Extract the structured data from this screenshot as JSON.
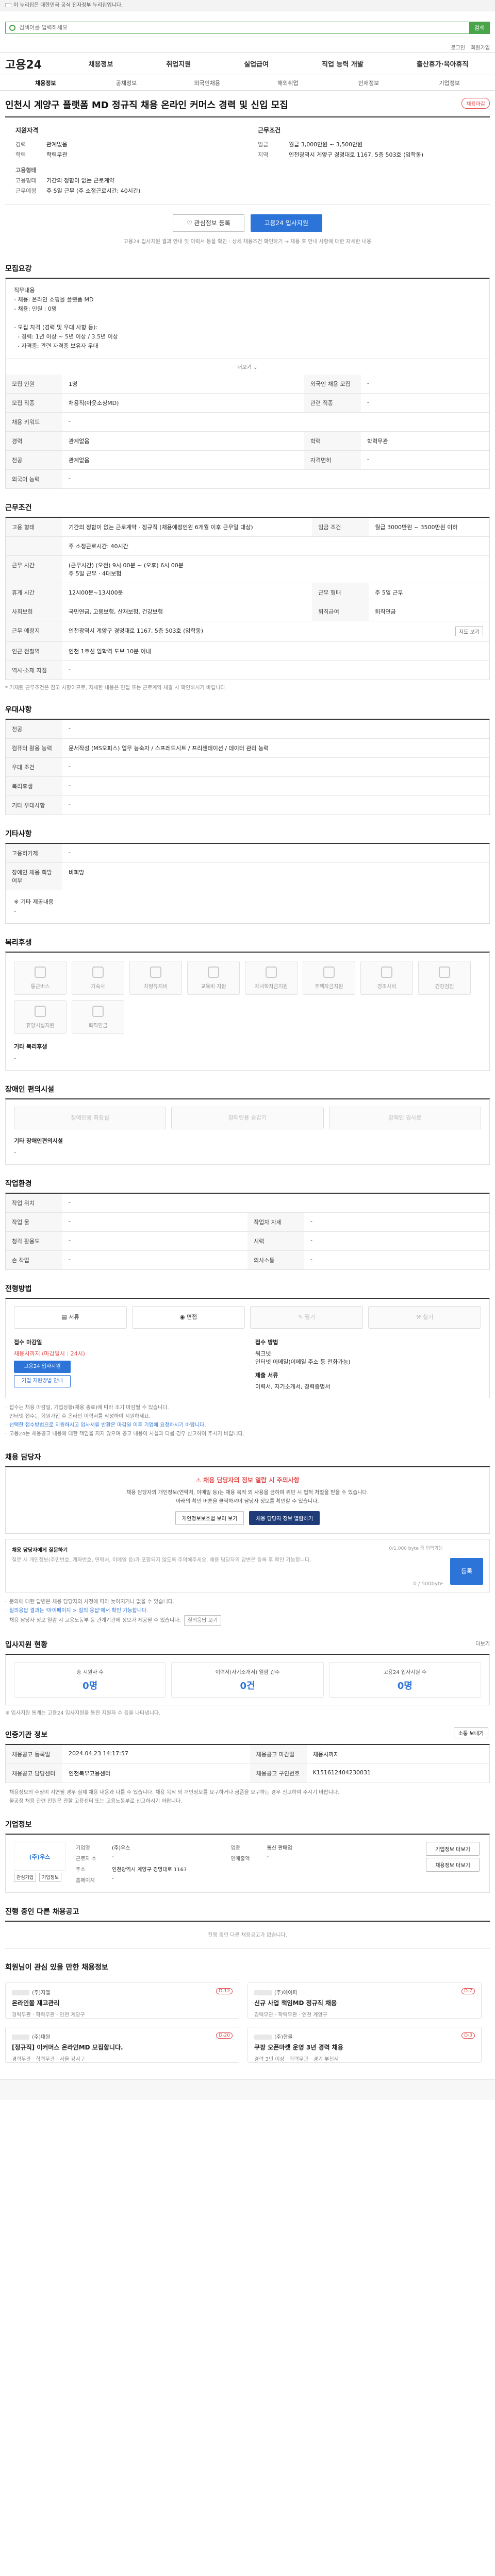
{
  "gov_banner": "이 누리집은 대한민국 공식 전자정부 누리집입니다.",
  "search": {
    "placeholder": "검색어를 입력하세요",
    "button": "검색"
  },
  "utils": [
    "로그인",
    "회원가입"
  ],
  "logo": {
    "text": "고용24"
  },
  "gnb": [
    "채용정보",
    "취업지원",
    "실업급여",
    "직업 능력 개발",
    "출산휴가·육아휴직"
  ],
  "subnav": [
    "채용정보",
    "공채정보",
    "외국인채용",
    "해외취업",
    "인재정보",
    "기업정보"
  ],
  "headline": {
    "title": "인천시 계양구 플랫폼 MD 정규직 채용 온라인 커머스 경력 및 신입 모집",
    "badge": "채용마감"
  },
  "summary": {
    "left": {
      "title": "지원자격",
      "rows": [
        {
          "k": "경력",
          "v": "관계없음"
        },
        {
          "k": "학력",
          "v": "학력무관"
        },
        {
          "k": "고용형태",
          "v": ""
        },
        {
          "k": "고용형태",
          "v": "기간의 정함이 없는 근로계약"
        },
        {
          "k": "근무예정",
          "v": "주 5일 근무 (주 소정근로시간: 40시간)"
        }
      ]
    },
    "right": {
      "title": "근무조건",
      "rows": [
        {
          "k": "임금",
          "v": "월급 3,000만원 ~ 3,500만원"
        },
        {
          "k": "지역",
          "v": "인천광역시 계양구 경명대로 1167, 5층 503호 (임학동)"
        }
      ]
    }
  },
  "actions": {
    "scrap": "관심정보 등록",
    "apply": "고용24 입사지원"
  },
  "actions_note": "고용24 입사지원 결과 안내 및 이력서 등을 확인 : 상세 채용조건 확인하기 → 채용 후 안내 사항에 대한 자세한 내용",
  "sections": {
    "recruit": "모집요강",
    "work": "근무조건",
    "benefit": "우대사항",
    "etc": "기타사항",
    "welfare": "복리후생",
    "disabled": "장애인 편의시설",
    "workenv": "작업환경",
    "method": "전형방법",
    "contact": "채용 담당자",
    "stats": "입사지원 현황",
    "info": "인증기관 정보",
    "company": "기업정보",
    "other": "진행 중인 다른 채용공고",
    "recommend": "회원님이 관심 있을 만한 채용정보"
  },
  "recruit": {
    "desc": "직무내용\n- 채용: 온라인 쇼핑몰 플랫폼 MD\n- 채용: 인원 : 0명\n\n- 모집 자격 (경력 및 우대 사항 등):\n  - 경력: 1년 이상 ~ 5년 이상 / 3.5년 이상\n  - 자격증: 관련 자격증 보유자 우대",
    "more": "더보기",
    "rows": [
      {
        "k": "모집 인원",
        "v": "1명",
        "k2": "외국인 채용 모집",
        "v2": "-"
      },
      {
        "k": "모집 직종",
        "v": "채용직(아웃소싱MD)",
        "k2": "관련 직종",
        "v2": "-"
      },
      {
        "k": "채용 키워드",
        "v": "-",
        "k2": "",
        "v2": ""
      },
      {
        "k": "경력",
        "v": "관계없음",
        "k2": "학력",
        "v2": "학력무관"
      },
      {
        "k": "전공",
        "v": "관계없음",
        "k2": "자격면허",
        "v2": "-"
      },
      {
        "k": "외국어 능력",
        "v": "-",
        "k2": "",
        "v2": ""
      }
    ]
  },
  "work": {
    "rows": [
      {
        "k": "고용 형태",
        "v": "기간의 정함이 없는 근로계약 · 정규직 (채용예정인원 6개월 이후 근무일 대상)",
        "k2": "임금 조건",
        "v2": "월급 3000만원 ~ 3500만원 이하"
      },
      {
        "k": "",
        "v": "주 소정근로시간: 40시간",
        "k2": "",
        "v2": ""
      },
      {
        "k": "근무 시간",
        "v": "(근무시간) (오전) 9시 00분 ~ (오후) 6시 00분\n주 5일 근무 · 4대보험",
        "k2": "",
        "v2": ""
      },
      {
        "k": "휴게 시간",
        "v": "12시00분~13시00분",
        "k2": "근무 형태",
        "v2": "주 5일 근무"
      },
      {
        "k": "사회보험",
        "v": "국민연금, 고용보험, 산재보험, 건강보험",
        "k2": "퇴직급여",
        "v2": "퇴직연금"
      },
      {
        "k": "근무 예정지",
        "v": "인천광역시 계양구 경명대로 1167, 5층 503호 (임학동)",
        "k2": "",
        "v2": "",
        "btn": "지도 보기"
      },
      {
        "k": "인근 전철역",
        "v": "인천 1호선 임학역 도보 10분 이내",
        "k2": "",
        "v2": ""
      },
      {
        "k": "역사·소재 지점",
        "v": "-",
        "k2": "",
        "v2": ""
      }
    ],
    "note": "* 기재된 근무조건은 참고 사항이므로, 자세한 내용은 면접 또는 근로계약 체결 시 확인하시기 바랍니다."
  },
  "benefit": {
    "rows": [
      {
        "k": "전공",
        "v": "-"
      },
      {
        "k": "컴퓨터 활용 능력",
        "v": "문서작성 (MS오피스) 업무 능숙자 / 스프레드시트 / 프리젠테이션 / 데이터 관리 능력"
      },
      {
        "k": "우대 조건",
        "v": "-"
      },
      {
        "k": "복리후생",
        "v": "-"
      },
      {
        "k": "기타 우대사항",
        "v": "-"
      }
    ]
  },
  "etc": {
    "rows": [
      {
        "k": "고용허가제",
        "v": "-"
      },
      {
        "k": "장애인 채용 희망 여부",
        "v": "비희망"
      }
    ],
    "extra_label": "※ 기타 제공내용",
    "extra_value": "-"
  },
  "welfare": {
    "items": [
      "통근버스",
      "기숙사",
      "차량유지비",
      "교육비 지원",
      "자녀학자금지원",
      "주택자금지원",
      "경조사비",
      "건강검진",
      "휴양시설지원",
      "퇴직연금"
    ],
    "sub": "기타 복리후생",
    "sub_value": "-"
  },
  "disabled": {
    "items": [
      "장애인용 화장실",
      "장애인용 승강기",
      "장애인 경사로"
    ],
    "sub": "기타 장애인편의시설",
    "sub_value": "-"
  },
  "workenv": {
    "rows": [
      {
        "k": "작업 위치",
        "v": "-",
        "k2": "",
        "v2": ""
      },
      {
        "k": "작업 물",
        "v": "-",
        "k2": "작업자 자세",
        "v2": "-"
      },
      {
        "k": "청각 활용도",
        "v": "-",
        "k2": "시력",
        "v2": "-"
      },
      {
        "k": "손 작업",
        "v": "-",
        "k2": "의사소통",
        "v2": "-"
      }
    ]
  },
  "method": {
    "steps": [
      "서류",
      "면접",
      "필기",
      "실기"
    ],
    "info1_title": "접수 마감일",
    "info1_value": "채용시까지 (마감일시 : 24시)",
    "info1_btn": "고용24 입사지원",
    "info1_btn2": "기업 지원방법 안내",
    "info2_title": "접수 방법",
    "info2_value": "워크넷\n인터넷 이메일(이메일 주소 등 전화가능)",
    "info3_title": "제출 서류",
    "info3_value": "이력서, 자기소개서, 경력증명서"
  },
  "method_notes": [
    "접수는 채용 마감일, 기업상황(채용 종료)에 따라 조기 마감될 수 있습니다.",
    "인터넷 접수는 회원가입 후 온라인 이력서를 작성하여 지원하세요.",
    "선택한 접수방법으로 지원하시고 입사서류 반환은 마감일 이후 기업에 요청하시기 바랍니다.",
    "고용24는 채용공고 내용에 대한 책임을 지지 않으며 공고 내용이 사실과 다를 경우 신고하여 주시기 바랍니다."
  ],
  "contact": {
    "title": "채용 담당자의 정보 열람 시 주의사항",
    "desc": "채용 담당자의 개인정보(연락처, 이메일 등)는 채용 목적 외 사용을 금하며 위반 시 법적 처벌을 받을 수 있습니다.\n아래의 확인 버튼을 클릭하셔야 담당자 정보를 확인할 수 있습니다.",
    "btn1": "개인정보보호법 보러 보기",
    "btn2": "채용 담당자 정보 열람하기",
    "qa_label": "채용 담당자에게 질문하기",
    "qa_hint": "질문 시 개인정보(주민번호, 계좌번호, 연락처, 이메일 등)가 포함되지 않도록 주의해주세요. 채용 담당자의 답변은 등록 후 확인 가능합니다.",
    "qa_count": "0 / 500byte",
    "qa_meta": "0/1,000 byte 중 입력가능",
    "qa_send": "등록",
    "bullets": [
      "문의에 대한 답변은 채용 담당자의 사정에 따라 늦어지거나 없을 수 있습니다.",
      "질의응답 결과는 '마이페이지 > 질의 응답'에서 확인 가능합니다.",
      "채용 담당자 정보 열람 시 고용노동부 등 관계기관에 정보가 제공될 수 있습니다."
    ],
    "more_btn": "질의응답 보기"
  },
  "stats": {
    "more": "더보기",
    "items": [
      {
        "label": "총 지원자 수",
        "value": "0명"
      },
      {
        "label": "이력서(자기소개서) 열람 건수",
        "value": "0건"
      },
      {
        "label": "고용24 입사지원 수",
        "value": "0명"
      }
    ],
    "note": "※ 입사지원 통계는 고용24 입사지원을 통한 지원자 수 등을 나타냅니다."
  },
  "info": {
    "rows": [
      {
        "k": "채용공고 등록일",
        "v": "2024.04.23 14:17:57",
        "k2": "채용공고 마감일",
        "v2": "채용시까지"
      },
      {
        "k": "채용공고 담당센터",
        "v": "인천북부고용센터",
        "k2": "채용공고 구인번호",
        "v2": "K151612404230031"
      }
    ],
    "notes": [
      "채용정보의 수정이 지연될 경우 실제 채용 내용과 다를 수 있습니다. 채용 목적 외 개인정보를 요구하거나 금품을 요구하는 경우 신고하여 주시기 바랍니다.",
      "불공정 채용 관련 민원은 관할 고용센터 또는 고용노동부로 신고하시기 바랍니다."
    ],
    "btn": "소통 보내기"
  },
  "company": {
    "name": "(주)우스",
    "btns": [
      "관심기업",
      "기업정보"
    ],
    "rows": [
      {
        "k": "기업명",
        "v": "(주)우스",
        "k2": "업종",
        "v2": "통신 판매업"
      },
      {
        "k": "근로자 수",
        "v": "-",
        "k2": "연매출액",
        "v2": "-"
      },
      {
        "k": "주소",
        "v": "인천광역시 계양구 경명대로 1167",
        "k2": "",
        "v2": ""
      },
      {
        "k": "홈페이지",
        "v": "-",
        "k2": "",
        "v2": ""
      }
    ],
    "right_btns": [
      "기업정보 더보기",
      "채용정보 더보기"
    ]
  },
  "other": {
    "empty": "진행 중인 다른 채용공고가 없습니다."
  },
  "recommend": {
    "cards": [
      {
        "co": "(주)지엘",
        "title": "온라인몰 재고관리",
        "meta": "경력무관 · 학력무관 · 인천 계양구",
        "tag": "D-12"
      },
      {
        "co": "(주)에이피",
        "title": "신규 사업 책임MD 정규직 채용",
        "meta": "경력무관 · 학력무관 · 인천 계양구",
        "tag": "D-7"
      },
      {
        "co": "(주)대원",
        "title": "[정규직] 이커머스 온라인MD 모집합니다.",
        "meta": "경력무관 · 학력무관 · 서울 강서구",
        "tag": "D-20"
      },
      {
        "co": "(주)한울",
        "title": "쿠팡 오픈마켓 운영 3년 경력 채용",
        "meta": "경력 3년 이상 · 학력무관 · 경기 부천시",
        "tag": "D-3"
      }
    ]
  }
}
